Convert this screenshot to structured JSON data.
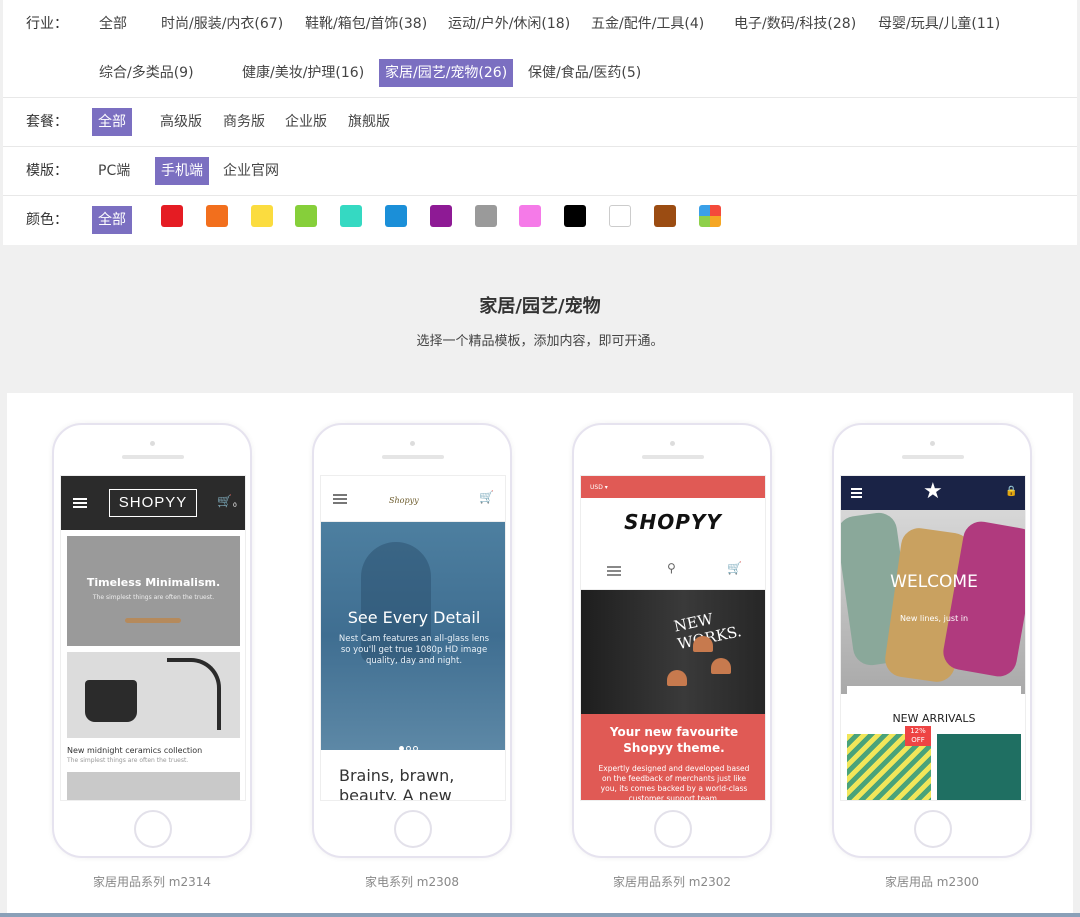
{
  "filters": {
    "industry": {
      "label": "行业：",
      "options": [
        "全部",
        "时尚/服装/内衣(67)",
        "鞋靴/箱包/首饰(38)",
        "运动/户外/休闲(18)",
        "五金/配件/工具(4)",
        "电子/数码/科技(28)",
        "母婴/玩具/儿童(11)",
        "综合/多类品(9)",
        "健康/美妆/护理(16)",
        "家居/园艺/宠物(26)",
        "保健/食品/医药(5)"
      ],
      "selected": "家居/园艺/宠物(26)"
    },
    "package": {
      "label": "套餐：",
      "options": [
        "全部",
        "高级版",
        "商务版",
        "企业版",
        "旗舰版"
      ],
      "selected": "全部"
    },
    "template": {
      "label": "模版：",
      "options": [
        "PC端",
        "手机端",
        "企业官网"
      ],
      "selected": "手机端"
    },
    "color": {
      "label": "颜色：",
      "all": "全部",
      "swatches": [
        "#e51c23",
        "#f26f1d",
        "#fbdc3f",
        "#86cf3a",
        "#35d9c2",
        "#1b8fd8",
        "#8e1a95",
        "#9a9a9a",
        "#f57ae8",
        "#000000",
        "#ffffff",
        "#9b4c12",
        "multi"
      ]
    }
  },
  "section": {
    "title": "家居/园艺/宠物",
    "subtitle": "选择一个精品模板，添加内容，即可开通。"
  },
  "templates": [
    {
      "caption": "家居用品系列 m2314",
      "screen": {
        "logo": "SHOPYY",
        "cart_count": "0",
        "hero_title": "Timeless Minimalism.",
        "hero_sub": "The simplest things are often the truest.",
        "item_title": "New midnight ceramics collection",
        "item_sub": "The simplest things are often the truest."
      }
    },
    {
      "caption": "家电系列 m2308",
      "screen": {
        "logo": "Shopyy",
        "hero_title": "See Every Detail",
        "hero_sub": "Nest Cam features an all-glass lens so you'll get true 1080p HD image quality, day and night.",
        "body_text": "Brains, brawn, beauty. A new"
      }
    },
    {
      "caption": "家居用品系列 m2302",
      "screen": {
        "currency": "USD ▾",
        "logo": "SHOPYY",
        "hero_text": "NEW WORKS.",
        "banner_title": "Your new favourite Shopyy theme.",
        "banner_sub": "Expertly designed and developed based on the feedback of merchants just like you, its comes backed by a world-class customer support team."
      }
    },
    {
      "caption": "家居用品 m2300",
      "screen": {
        "hero_title": "WELCOME",
        "hero_sub": "New lines, just in",
        "section_title": "NEW ARRIVALS",
        "badge": "12% OFF"
      }
    }
  ]
}
